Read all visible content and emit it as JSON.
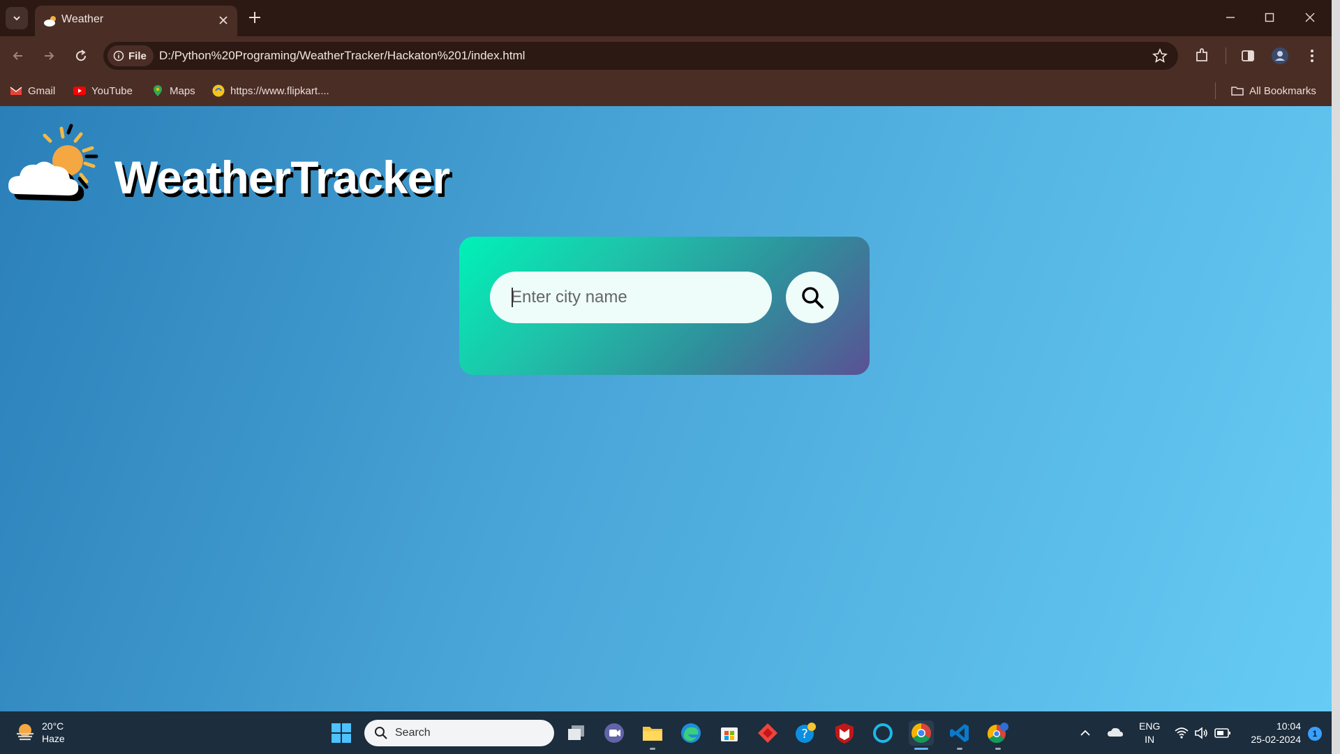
{
  "browser": {
    "tab_title": "Weather",
    "url_chip": "File",
    "url": "D:/Python%20Programing/WeatherTracker/Hackaton%201/index.html",
    "bookmarks": [
      {
        "label": "Gmail",
        "icon": "gmail-icon"
      },
      {
        "label": "YouTube",
        "icon": "youtube-icon"
      },
      {
        "label": "Maps",
        "icon": "maps-icon"
      },
      {
        "label": "https://www.flipkart....",
        "icon": "flipkart-icon"
      }
    ],
    "all_bookmarks": "All Bookmarks"
  },
  "app": {
    "brand": "WeatherTracker",
    "search_placeholder": "Enter city name"
  },
  "taskbar": {
    "weather_temp": "20°C",
    "weather_desc": "Haze",
    "search_label": "Search",
    "lang_top": "ENG",
    "lang_bottom": "IN",
    "time": "10:04",
    "date": "25-02-2024",
    "notification_count": "1"
  },
  "colors": {
    "page_gradient_start": "#2a7fb8",
    "page_gradient_end": "#66ccf5",
    "card_gradient_start": "#00f2b8",
    "card_gradient_end": "#5a5195",
    "chrome_bg": "#4a2e26",
    "taskbar_bg": "#1c2d3d"
  }
}
